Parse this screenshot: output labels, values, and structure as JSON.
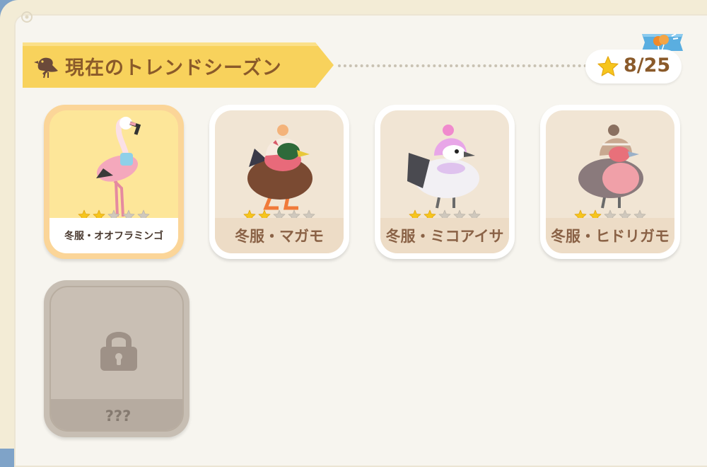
{
  "header": {
    "title": "現在のトレンドシーズン",
    "progress_label": "8/25",
    "collected": 8,
    "total": 25
  },
  "colors": {
    "banner": "#f8d25c",
    "title_text": "#8a5a2a",
    "star_on": "#f6c51d",
    "star_off": "#cfc8bd"
  },
  "cards": [
    {
      "name": "冬服・オオフラミンゴ",
      "stars": 2,
      "max_stars": 5,
      "selected": true
    },
    {
      "name": "冬服・マガモ",
      "stars": 2,
      "max_stars": 5,
      "selected": false
    },
    {
      "name": "冬服・ミコアイサ",
      "stars": 2,
      "max_stars": 5,
      "selected": false
    },
    {
      "name": "冬服・ヒドリガモ",
      "stars": 2,
      "max_stars": 5,
      "selected": false
    }
  ],
  "locked_card": {
    "label": "???"
  }
}
